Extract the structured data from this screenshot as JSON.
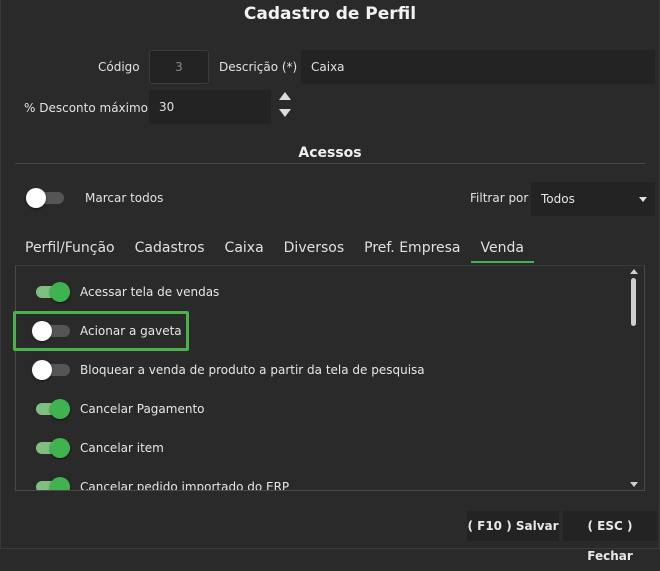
{
  "window": {
    "title": "Cadastro de Perfil"
  },
  "form": {
    "codigo_label": "Código",
    "codigo_value": "3",
    "descricao_label": "Descrição (*)",
    "descricao_value": "Caixa",
    "desconto_label": "% Desconto máximo",
    "desconto_value": "30"
  },
  "acessos": {
    "title": "Acessos",
    "marcar_todos_label": "Marcar todos",
    "marcar_todos_on": false,
    "filtrar_label": "Filtrar por",
    "filtrar_value": "Todos"
  },
  "tabs": [
    {
      "label": "Perfil/Função",
      "active": false
    },
    {
      "label": "Cadastros",
      "active": false
    },
    {
      "label": "Caixa",
      "active": false
    },
    {
      "label": "Diversos",
      "active": false
    },
    {
      "label": "Pref. Empresa",
      "active": false
    },
    {
      "label": "Venda",
      "active": true
    }
  ],
  "permissions": [
    {
      "label": "Acessar tela de vendas",
      "on": true
    },
    {
      "label": "Acionar a gaveta",
      "on": false
    },
    {
      "label": "Bloquear a venda de produto a partir da tela de pesquisa",
      "on": false
    },
    {
      "label": "Cancelar Pagamento",
      "on": true
    },
    {
      "label": "Cancelar item",
      "on": true
    },
    {
      "label": "Cancelar pedido importado do ERP",
      "on": true
    }
  ],
  "footer": {
    "save_label": "( F10 ) Salvar",
    "close_label": "( ESC ) Fechar"
  },
  "colors": {
    "accent": "#3fb34f",
    "background": "#2a2a2a",
    "field": "#232323",
    "highlight": "#4bb24b"
  }
}
